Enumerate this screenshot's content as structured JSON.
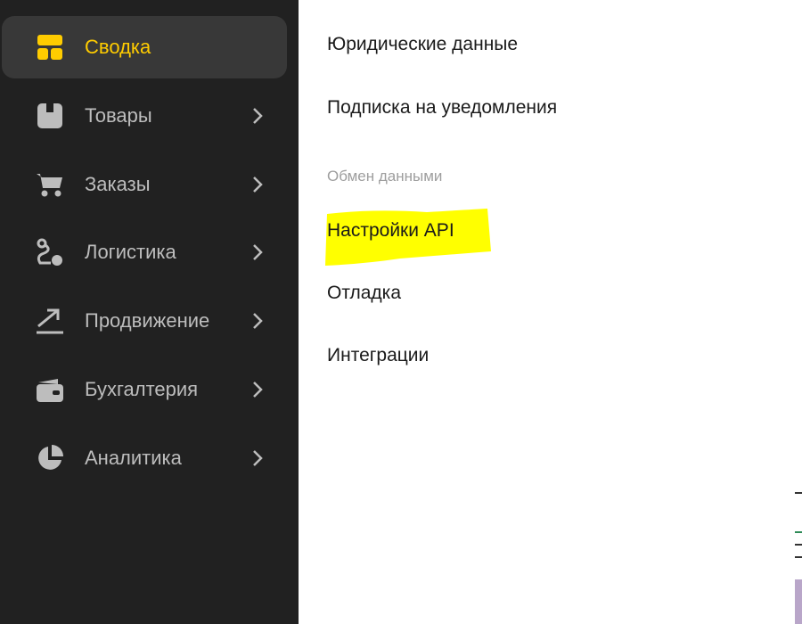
{
  "sidebar": {
    "items": [
      {
        "label": "Сводка",
        "icon": "dashboard-icon",
        "active": true
      },
      {
        "label": "Товары",
        "icon": "box-icon",
        "has_submenu": true
      },
      {
        "label": "Заказы",
        "icon": "cart-icon",
        "has_submenu": true
      },
      {
        "label": "Логистика",
        "icon": "route-icon",
        "has_submenu": true
      },
      {
        "label": "Продвижение",
        "icon": "trend-up-icon",
        "has_submenu": true
      },
      {
        "label": "Бухгалтерия",
        "icon": "wallet-icon",
        "has_submenu": true
      },
      {
        "label": "Аналитика",
        "icon": "pie-chart-icon",
        "has_submenu": true
      }
    ]
  },
  "submenu": {
    "items": [
      {
        "label": "Юридические данные"
      },
      {
        "label": "Подписка на уведомления"
      },
      {
        "section": "Обмен данными"
      },
      {
        "label": "Настройки API",
        "highlighted": true
      },
      {
        "label": "Отладка"
      },
      {
        "label": "Интеграции"
      }
    ]
  },
  "colors": {
    "sidebar_bg": "#212121",
    "active_item_bg": "#383838",
    "accent": "#ffcc00",
    "highlight": "#ffff00",
    "nav_text": "#bdbdbd",
    "section_text": "#9e9e9e"
  }
}
